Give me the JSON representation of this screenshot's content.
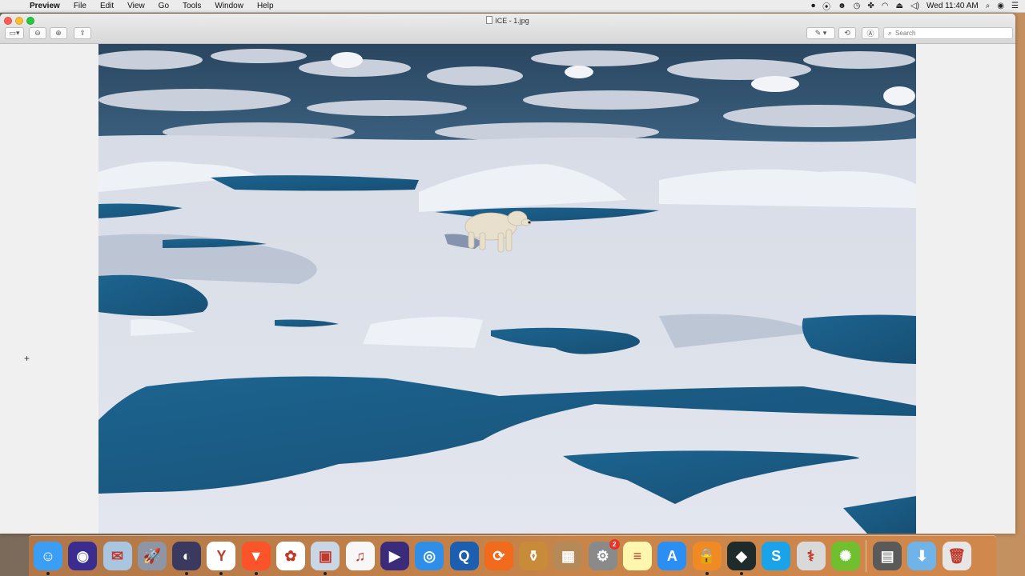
{
  "menubar": {
    "app": "Preview",
    "menus": [
      "File",
      "Edit",
      "View",
      "Go",
      "Tools",
      "Window",
      "Help"
    ],
    "clock": "Wed 11:40 AM",
    "status_icons": [
      "screen-record-icon",
      "podcast-icon",
      "character-icon",
      "time-machine-icon",
      "paw-icon",
      "wifi-icon",
      "eject-icon",
      "volume-icon",
      "spotlight-icon",
      "siri-icon",
      "notification-center-icon"
    ]
  },
  "window": {
    "title": "ICE - 1.jpg",
    "search_placeholder": "Search"
  },
  "image": {
    "subject": "polar-bear-on-sea-ice",
    "colors": {
      "ice": "#d9dde7",
      "water": "#1f5f86",
      "shadow": "#a9b4c7"
    }
  },
  "dock": {
    "apps": [
      {
        "name": "finder",
        "color": "#3a9ef5",
        "glyph": "☺",
        "running": true
      },
      {
        "name": "siri",
        "color": "#3b2c8f",
        "glyph": "◉",
        "running": false
      },
      {
        "name": "mail-bird",
        "color": "#a9c6e0",
        "glyph": "✉",
        "running": false
      },
      {
        "name": "launchpad",
        "color": "#8e95a4",
        "glyph": "🚀",
        "running": false
      },
      {
        "name": "steam-helmet",
        "color": "#3a3a60",
        "glyph": "◐",
        "running": true
      },
      {
        "name": "yandex",
        "color": "#ffffff",
        "glyph": "Y",
        "running": true
      },
      {
        "name": "brave",
        "color": "#fb542b",
        "glyph": "▼",
        "running": true
      },
      {
        "name": "photos",
        "color": "#ffffff",
        "glyph": "✿",
        "running": false
      },
      {
        "name": "preview",
        "color": "#c9d6e6",
        "glyph": "▣",
        "running": true
      },
      {
        "name": "itunes",
        "color": "#f7f7f7",
        "glyph": "♫",
        "running": false
      },
      {
        "name": "prime-video",
        "color": "#3a2c7a",
        "glyph": "▶",
        "running": false
      },
      {
        "name": "safari",
        "color": "#2f8fe8",
        "glyph": "◎",
        "running": false
      },
      {
        "name": "quicktime",
        "color": "#1c5fb0",
        "glyph": "Q",
        "running": false
      },
      {
        "name": "istat",
        "color": "#f26a1b",
        "glyph": "⟳",
        "running": false
      },
      {
        "name": "jar",
        "color": "#c88b3a",
        "glyph": "⚱",
        "running": false
      },
      {
        "name": "box-archive",
        "color": "#b58a58",
        "glyph": "▦",
        "running": false
      },
      {
        "name": "system-preferences",
        "color": "#8a8a8a",
        "glyph": "⚙",
        "running": false,
        "badge": "2"
      },
      {
        "name": "notes",
        "color": "#fff6b0",
        "glyph": "≡",
        "running": false
      },
      {
        "name": "app-store",
        "color": "#2b8ef3",
        "glyph": "A",
        "running": false
      },
      {
        "name": "vpn-lock",
        "color": "#f08a25",
        "glyph": "🔒",
        "running": true
      },
      {
        "name": "filmora",
        "color": "#1f2a2a",
        "glyph": "◆",
        "running": true
      },
      {
        "name": "skype",
        "color": "#1aa3e8",
        "glyph": "S",
        "running": false
      },
      {
        "name": "disk-utility",
        "color": "#d9d9d9",
        "glyph": "⚕",
        "running": false
      },
      {
        "name": "motion-reel",
        "color": "#6fbf2e",
        "glyph": "✺",
        "running": false
      }
    ],
    "stacks": [
      {
        "name": "scanner",
        "color": "#5a5a5a",
        "glyph": "▤"
      },
      {
        "name": "downloads-folder",
        "color": "#6fb3e8",
        "glyph": "⬇"
      },
      {
        "name": "trash",
        "color": "#e6e6e6",
        "glyph": "🗑"
      }
    ]
  }
}
